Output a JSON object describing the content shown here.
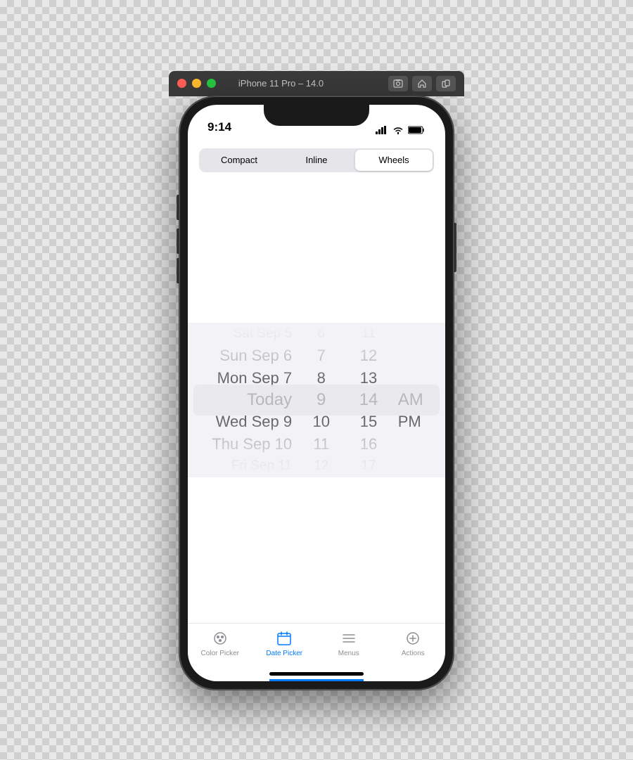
{
  "simulator": {
    "title": "iPhone 11 Pro – 14.0"
  },
  "status_bar": {
    "time": "9:14"
  },
  "segment_control": {
    "tabs": [
      {
        "id": "compact",
        "label": "Compact",
        "active": false
      },
      {
        "id": "inline",
        "label": "Inline",
        "active": false
      },
      {
        "id": "wheels",
        "label": "Wheels",
        "active": true
      }
    ]
  },
  "date_picker": {
    "rows": [
      {
        "date": "Sat Sep 5",
        "hour": "6",
        "minute": "11",
        "ampm": "",
        "state": "far"
      },
      {
        "date": "Sun Sep 6",
        "hour": "7",
        "minute": "12",
        "ampm": "",
        "state": "dim"
      },
      {
        "date": "Mon Sep 7",
        "hour": "8",
        "minute": "13",
        "ampm": "",
        "state": "normal"
      },
      {
        "date": "Today",
        "hour": "9",
        "minute": "14",
        "ampm": "AM",
        "state": "selected"
      },
      {
        "date": "Wed Sep 9",
        "hour": "10",
        "minute": "15",
        "ampm": "PM",
        "state": "normal"
      },
      {
        "date": "Thu Sep 10",
        "hour": "11",
        "minute": "16",
        "ampm": "",
        "state": "dim"
      },
      {
        "date": "Fri Sep 11",
        "hour": "12",
        "minute": "17",
        "ampm": "",
        "state": "far"
      }
    ]
  },
  "tab_bar": {
    "items": [
      {
        "id": "color-picker",
        "label": "Color Picker",
        "active": false
      },
      {
        "id": "date-picker",
        "label": "Date Picker",
        "active": true
      },
      {
        "id": "menus",
        "label": "Menus",
        "active": false
      },
      {
        "id": "actions",
        "label": "Actions",
        "active": false
      }
    ]
  },
  "colors": {
    "active_tab": "#007aff",
    "inactive_tab": "#8e8e93",
    "selected_segment": "#ffffff",
    "segment_bg": "#e5e5ea"
  }
}
